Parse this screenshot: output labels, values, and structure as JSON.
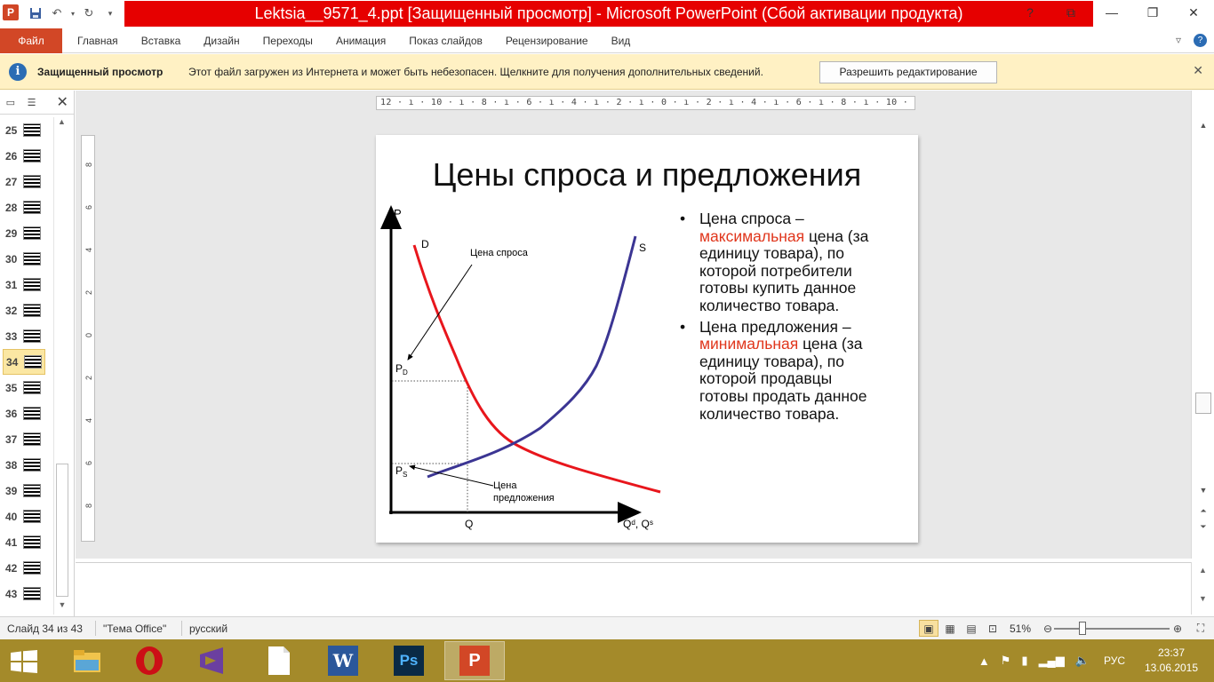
{
  "window": {
    "title": "Lektsia__9571_4.ppt [Защищенный просмотр] - Microsoft PowerPoint (Сбой активации продукта)",
    "app_icon_letter": "P",
    "qat": [
      "save-icon",
      "undo-icon",
      "redo-icon",
      "customize-icon"
    ]
  },
  "ribbon": {
    "file_tab": "Файл",
    "tabs": [
      "Главная",
      "Вставка",
      "Дизайн",
      "Переходы",
      "Анимация",
      "Показ слайдов",
      "Рецензирование",
      "Вид"
    ]
  },
  "message_bar": {
    "title": "Защищенный просмотр",
    "text": "Этот файл загружен из Интернета и может быть небезопасен. Щелкните для получения дополнительных сведений.",
    "button": "Разрешить редактирование"
  },
  "slides_panel": {
    "items": [
      {
        "num": "25"
      },
      {
        "num": "26"
      },
      {
        "num": "27"
      },
      {
        "num": "28"
      },
      {
        "num": "29"
      },
      {
        "num": "30"
      },
      {
        "num": "31"
      },
      {
        "num": "32"
      },
      {
        "num": "33"
      },
      {
        "num": "34",
        "active": true
      },
      {
        "num": "35"
      },
      {
        "num": "36"
      },
      {
        "num": "37"
      },
      {
        "num": "38"
      },
      {
        "num": "39"
      },
      {
        "num": "40"
      },
      {
        "num": "41"
      },
      {
        "num": "42"
      },
      {
        "num": "43"
      }
    ]
  },
  "ruler": {
    "horizontal": "12 · ı · 10 · ı · 8 · ı · 6 · ı · 4 · ı · 2 · ı · 0 · ı · 2 · ı · 4 · ı · 6 · ı · 8 · ı · 10 · ı · 12",
    "vertical_marks": [
      "8",
      "6",
      "4",
      "2",
      "0",
      "2",
      "4",
      "6",
      "8"
    ]
  },
  "slide": {
    "title": "Цены спроса и предложения",
    "bullet1": {
      "before": "Цена спроса –",
      "highlight": "максимальная",
      "after": "цена (за единицу товара), по которой потребители готовы купить данное количество товара."
    },
    "bullet2": {
      "before": "Цена предложения –",
      "highlight": "минимальная",
      "after": "цена (за единицу товара), по которой продавцы готовы продать данное количество товара."
    },
    "graph": {
      "axis_p": "P",
      "axis_q": "Qᵈ, Qˢ",
      "label_d": "D",
      "label_s": "S",
      "label_pd_main": "P",
      "label_pd_sub": "D",
      "label_ps_main": "P",
      "label_ps_sub": "S",
      "label_q": "Q",
      "ann_demand": "Цена спроса",
      "ann_supply_1": "Цена",
      "ann_supply_2": "предложения",
      "demand_color": "#e8161c",
      "supply_color": "#3b3593"
    }
  },
  "status": {
    "slide": "Слайд 34 из 43",
    "theme": "\"Тема Office\"",
    "lang": "русский",
    "zoom": "51%"
  },
  "taskbar": {
    "apps": [
      "file-explorer",
      "opera",
      "visual-studio",
      "document",
      "word",
      "photoshop",
      "powerpoint"
    ],
    "lang": "РУС",
    "time": "23:37",
    "date": "13.06.2015"
  }
}
